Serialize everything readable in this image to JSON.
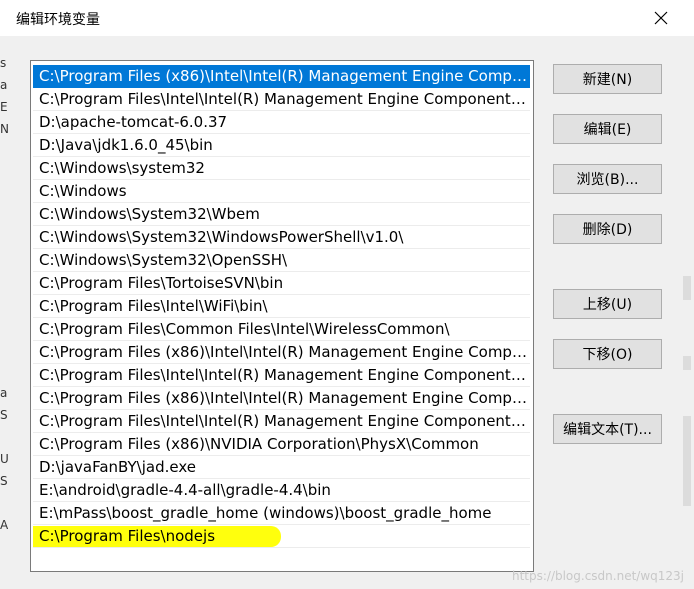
{
  "dialog": {
    "title": "编辑环境变量"
  },
  "paths": [
    "C:\\Program Files (x86)\\Intel\\Intel(R) Management Engine Compon...",
    "C:\\Program Files\\Intel\\Intel(R) Management Engine Components\\i...",
    "D:\\apache-tomcat-6.0.37",
    "D:\\Java\\jdk1.6.0_45\\bin",
    "C:\\Windows\\system32",
    "C:\\Windows",
    "C:\\Windows\\System32\\Wbem",
    "C:\\Windows\\System32\\WindowsPowerShell\\v1.0\\",
    "C:\\Windows\\System32\\OpenSSH\\",
    "C:\\Program Files\\TortoiseSVN\\bin",
    "C:\\Program Files\\Intel\\WiFi\\bin\\",
    "C:\\Program Files\\Common Files\\Intel\\WirelessCommon\\",
    "C:\\Program Files (x86)\\Intel\\Intel(R) Management Engine Compon...",
    "C:\\Program Files\\Intel\\Intel(R) Management Engine Components\\...",
    "C:\\Program Files (x86)\\Intel\\Intel(R) Management Engine Compon...",
    "C:\\Program Files\\Intel\\Intel(R) Management Engine Components\\I...",
    "C:\\Program Files (x86)\\NVIDIA Corporation\\PhysX\\Common",
    "D:\\javaFanBY\\jad.exe",
    "E:\\android\\gradle-4.4-all\\gradle-4.4\\bin",
    "E:\\mPass\\boost_gradle_home (windows)\\boost_gradle_home",
    "C:\\Program Files\\nodejs"
  ],
  "buttons": {
    "new": "新建(N)",
    "edit": "编辑(E)",
    "browse": "浏览(B)...",
    "delete": "删除(D)",
    "move_up": "上移(U)",
    "move_down": "下移(O)",
    "edit_text": "编辑文本(T)..."
  },
  "background": {
    "left_chars": [
      "s",
      "a",
      "E",
      "N",
      "a",
      "S",
      "U",
      "S",
      "A"
    ]
  },
  "watermark": "https://blog.csdn.net/wq123j",
  "colors": {
    "selection": "#0078d7",
    "highlight": "#ffff00"
  }
}
